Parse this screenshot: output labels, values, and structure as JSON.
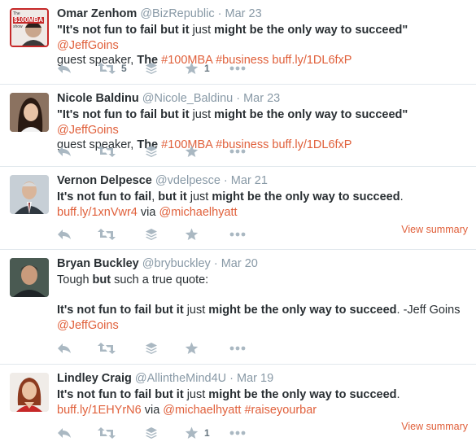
{
  "tweets": [
    {
      "name": "Omar Zenhom",
      "handle": "@BizRepublic",
      "date": "Mar 23",
      "line1": [
        "\"It's not fun to fail but it",
        " just ",
        "might be the only way to succeed",
        "\" ",
        "@JeffGoins"
      ],
      "line2": [
        "guest speaker, ",
        "The",
        " ",
        "#100MBA",
        " ",
        "#business",
        " ",
        "buff.ly/1DL6fxP"
      ],
      "retweets": "5",
      "favorites": "1"
    },
    {
      "name": "Nicole Baldinu",
      "handle": "@Nicole_Baldinu",
      "date": "Mar 23",
      "line1": [
        "\"It's not fun to fail but it",
        " just ",
        "might be the only way to succeed",
        "\" ",
        "@JeffGoins"
      ],
      "line2": [
        "guest speaker, ",
        "The",
        " ",
        "#100MBA",
        " ",
        "#business",
        " ",
        "buff.ly/1DL6fxP"
      ]
    },
    {
      "name": "Vernon Delpesce",
      "handle": "@vdelpesce",
      "date": "Mar 21",
      "line1": [
        "It's not fun to fail",
        ", ",
        "but it",
        " just ",
        "might be the only way to succeed",
        "."
      ],
      "line2": [
        "buff.ly/1xnVwr4",
        " via ",
        "@michaelhyatt"
      ],
      "summary": "View summary"
    },
    {
      "name": "Bryan Buckley",
      "handle": "@brybuckley",
      "date": "Mar 20",
      "line1": [
        "Tough ",
        "but",
        " such a true quote:"
      ],
      "line3": [
        "It's not fun to fail but it",
        " just ",
        "might be the only way to succeed",
        ". -Jeff Goins"
      ],
      "line4": "@JeffGoins"
    },
    {
      "name": "Lindley Craig",
      "handle": "@AllintheMind4U",
      "date": "Mar 19",
      "line1": [
        "It's not fun to fail but it",
        " just ",
        "might be the only way to succeed",
        "."
      ],
      "line2": [
        "buff.ly/1EHYrN6",
        " via ",
        "@michaelhyatt",
        " ",
        "#raiseyourbar"
      ],
      "favorites": "1",
      "summary": "View summary"
    }
  ],
  "avatar_logo": {
    "line1": "The",
    "line2": "$100MBA",
    "line3": "show"
  },
  "sep": " · ",
  "icons": [
    "reply-icon",
    "retweet-icon",
    "buffer-icon",
    "favorite-icon",
    "more-icon"
  ],
  "colors": {
    "link": "#e0603b",
    "meta": "#8899a6",
    "action": "#aab8c2",
    "divider": "#e1e8ed"
  }
}
